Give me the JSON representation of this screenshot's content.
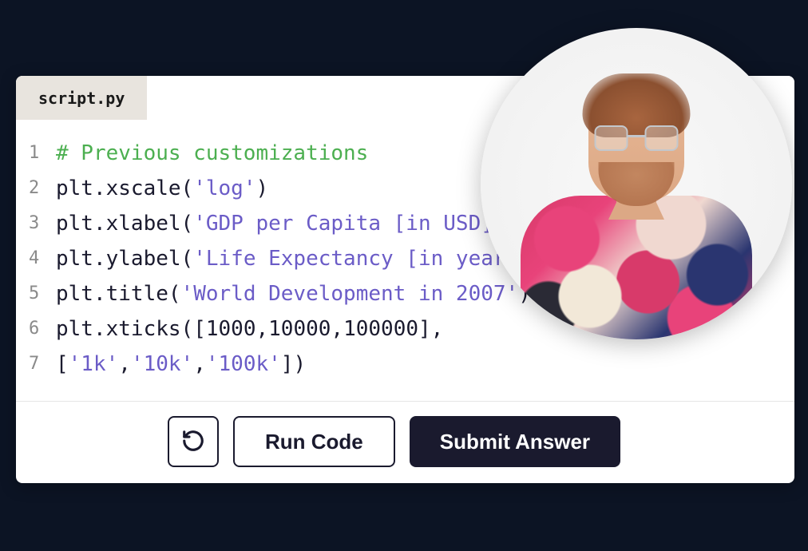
{
  "tab": {
    "filename": "script.py"
  },
  "code": {
    "line_numbers": [
      "1",
      "2",
      "3",
      "4",
      "5",
      "6",
      "7"
    ],
    "lines": [
      {
        "type": "comment",
        "text": "# Previous customizations"
      },
      {
        "prefix": "plt.xscale",
        "paren_open": "(",
        "string": "'log'",
        "paren_close": ")"
      },
      {
        "prefix": "plt.xlabel",
        "paren_open": "(",
        "string": "'GDP per Capita [in USD]'",
        "paren_close": ")"
      },
      {
        "prefix": "plt.ylabel",
        "paren_open": "(",
        "string": "'Life Expectancy [in years]'",
        "paren_close": ")"
      },
      {
        "prefix": "plt.title",
        "paren_open": "(",
        "string": "'World Development in 2007'",
        "paren_close": ")"
      },
      {
        "prefix": "plt.xticks",
        "paren_open": "(",
        "list_open": "[",
        "n1": "1000",
        "c1": ",",
        "n2": "10000",
        "c2": ",",
        "n3": "100000",
        "list_close": "]",
        "trailing_comma": ","
      },
      {
        "list_open": "[",
        "s1": "'1k'",
        "c1": ",",
        "s2": "'10k'",
        "c2": ",",
        "s3": "'100k'",
        "list_close": "]",
        "paren_close": ")"
      }
    ]
  },
  "toolbar": {
    "reset_icon": "reset",
    "run_label": "Run Code",
    "submit_label": "Submit Answer"
  },
  "avatar": {
    "description": "instructor-photo"
  }
}
